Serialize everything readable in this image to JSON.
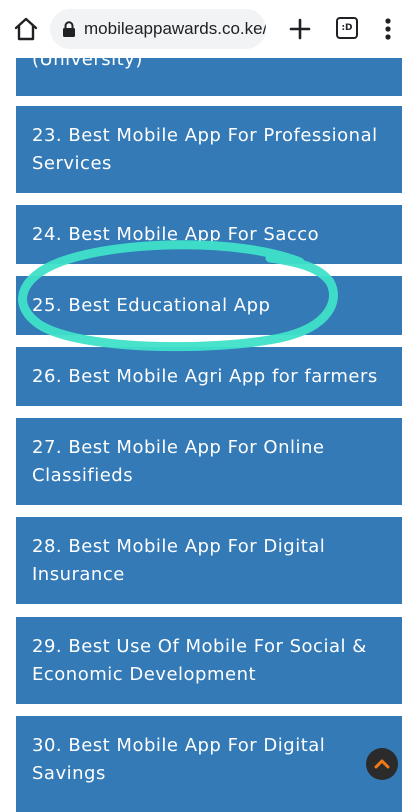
{
  "browser": {
    "url": "mobileappawards.co.ke/",
    "tab_count": ":D",
    "icons": {
      "home": "home-icon",
      "lock": "lock-icon",
      "new_tab": "plus-icon",
      "tabs": "tab-switcher-icon",
      "menu": "more-vert-icon"
    }
  },
  "categories": [
    {
      "label": "(University)"
    },
    {
      "label": "23. Best Mobile App For Professional Services"
    },
    {
      "label": "24. Best Mobile App For Sacco"
    },
    {
      "label": "25. Best Educational App"
    },
    {
      "label": "26. Best Mobile Agri App for farmers"
    },
    {
      "label": "27. Best Mobile App For Online Classifieds"
    },
    {
      "label": "28. Best Mobile App For Digital Insurance"
    },
    {
      "label": "29. Best Use Of Mobile For Social & Economic Development"
    },
    {
      "label": "30. Best Mobile App For Digital Savings"
    }
  ],
  "colors": {
    "card_background": "#337ab7",
    "highlight_stroke": "#3fe0c8",
    "scroll_button": "#2b2b2b",
    "scroll_arrow": "#f07a1a"
  },
  "scroll_top_icon": "chevron-up-icon"
}
